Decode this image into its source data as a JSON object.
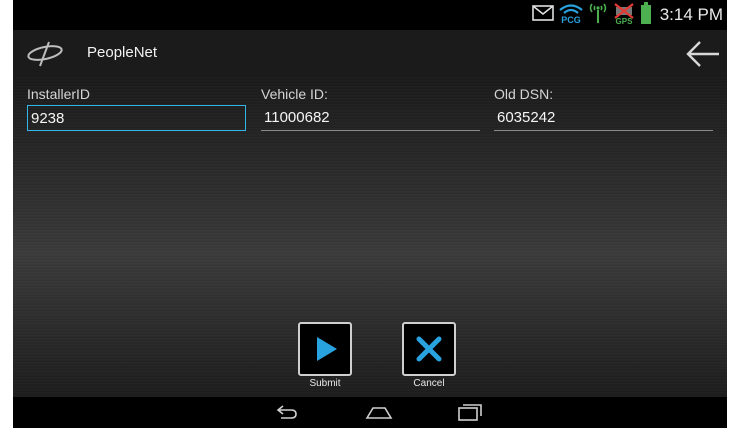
{
  "status_bar": {
    "time": "3:14 PM",
    "icons": [
      "mail-icon",
      "pcg-wifi-icon",
      "signal-icon",
      "gps-off-icon",
      "battery-icon"
    ],
    "pcg_label": "PCG",
    "gps_label": "GPS",
    "battery_color": "#4caf50"
  },
  "app_bar": {
    "title": "PeopleNet",
    "back_icon": "back-arrow-icon"
  },
  "form": {
    "installer_id": {
      "label": "InstallerID",
      "value": "9238"
    },
    "vehicle_id": {
      "label": "Vehicle ID:",
      "value": "11000682"
    },
    "old_dsn": {
      "label": "Old DSN:",
      "value": "6035242"
    }
  },
  "actions": {
    "submit_label": "Submit",
    "cancel_label": "Cancel",
    "icon_color": "#29a3e0"
  },
  "nav_bar": {
    "icons": [
      "back-nav-icon",
      "home-nav-icon",
      "recent-apps-icon"
    ]
  },
  "colors": {
    "accent": "#33b5e5"
  }
}
